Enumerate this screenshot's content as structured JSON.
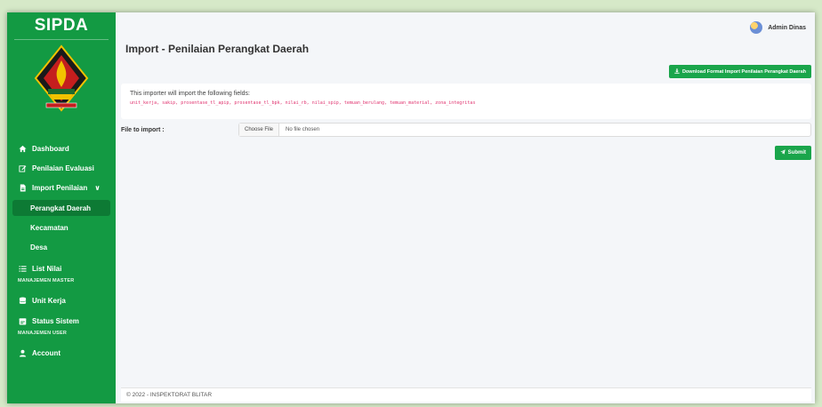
{
  "app": {
    "brand": "SIPDA"
  },
  "sidebar": {
    "items": [
      {
        "label": "Dashboard",
        "icon": "home-icon"
      },
      {
        "label": "Penilaian Evaluasi",
        "icon": "edit-icon"
      },
      {
        "label": "Import Penilaian",
        "icon": "file-import-icon",
        "chevron": "∨"
      },
      {
        "label": "Perangkat Daerah"
      },
      {
        "label": "Kecamatan"
      },
      {
        "label": "Desa"
      },
      {
        "label": "List Nilai",
        "icon": "list-icon"
      }
    ],
    "header_master": "MANAJEMEN MASTER",
    "master_items": [
      {
        "label": "Unit Kerja",
        "icon": "database-icon"
      },
      {
        "label": "Status Sistem",
        "icon": "calendar-icon"
      }
    ],
    "header_user": "MANAJEMEN USER",
    "user_items": [
      {
        "label": "Account",
        "icon": "user-icon"
      }
    ]
  },
  "topbar": {
    "user_name": "Admin Dinas"
  },
  "page": {
    "title": "Import - Penilaian Perangkat Daerah",
    "download_label": "Download Format Import Penilaian Perangkat Daerah",
    "info_text": "This importer will import the following fields:",
    "fields_text": "unit_kerja, sakip, prosentase_tl_apip, prosentase_tl_bpk, nilai_rb, nilai_spip, temuan_berulang, temuan_material, zona_integritas",
    "file_label": "File to import :",
    "choose_file": "Choose File",
    "no_file": "No file chosen",
    "submit_label": "Submit"
  },
  "footer": {
    "text": "© 2022 - INSPEKTORAT BLITAR"
  },
  "colors": {
    "sidebar": "#139a43",
    "active": "#0d7a34",
    "button": "#1aa54b",
    "fields": "#e0336f"
  }
}
